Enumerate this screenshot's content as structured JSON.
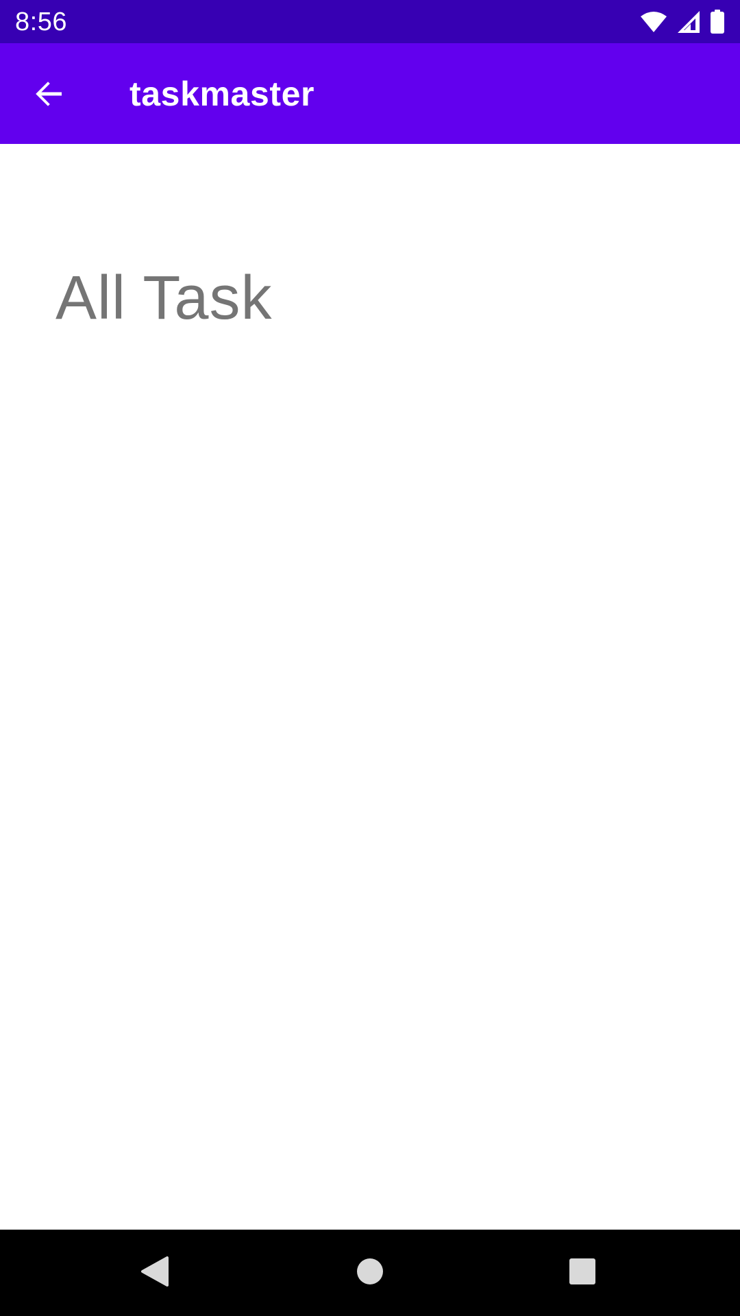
{
  "status_bar": {
    "time": "8:56",
    "icons": [
      "wifi-icon",
      "signal-icon",
      "battery-icon"
    ],
    "background": "#3700B3"
  },
  "app_bar": {
    "title": "taskmaster",
    "back_icon": "arrow-back-icon",
    "background": "#6200EE"
  },
  "main": {
    "heading": "All Task"
  },
  "nav_bar": {
    "buttons": [
      "back-triangle-icon",
      "home-circle-icon",
      "recents-square-icon"
    ],
    "background": "#000000"
  }
}
